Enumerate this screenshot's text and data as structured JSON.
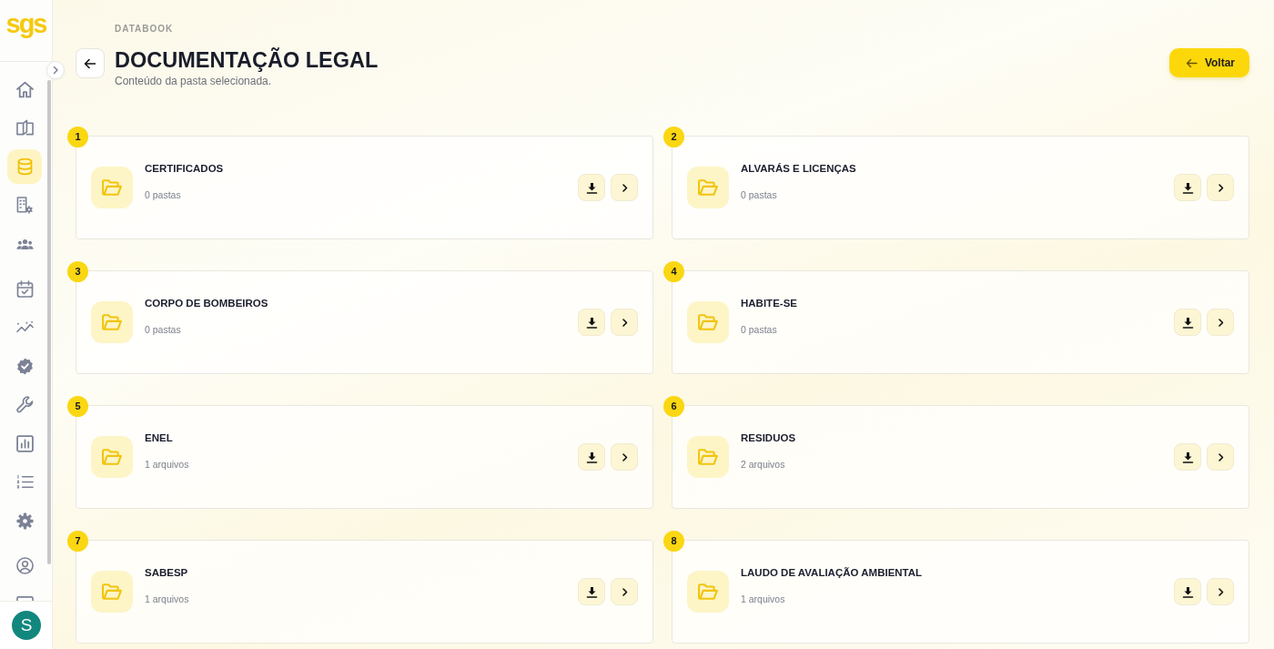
{
  "sidebar": {
    "logo": "sgs",
    "expanded": false,
    "sections": [
      {
        "items": [
          {
            "selected": false
          },
          {
            "selected": false
          },
          {
            "selected": true
          },
          {
            "selected": false
          },
          {
            "selected": false
          }
        ]
      },
      {
        "items": [
          {
            "selected": false
          },
          {
            "selected": false
          },
          {
            "selected": false
          },
          {
            "selected": false
          },
          {
            "selected": false
          },
          {
            "selected": false
          },
          {
            "selected": false
          }
        ]
      },
      {
        "items": [
          {
            "selected": false
          },
          {
            "selected": false
          }
        ]
      }
    ],
    "avatar": "S"
  },
  "header": {
    "breadcrumb": "DATABOOK",
    "title": "DOCUMENTAÇÃO LEGAL",
    "subtitle": "Conteúdo da pasta selecionada.",
    "back_button": "Voltar"
  },
  "folders": [
    {
      "number": "1",
      "title": "CERTIFICADOS",
      "count": "0 pastas"
    },
    {
      "number": "2",
      "title": "ALVARÁS E LICENÇAS",
      "count": "0 pastas"
    },
    {
      "number": "3",
      "title": "CORPO DE BOMBEIROS",
      "count": "0 pastas"
    },
    {
      "number": "4",
      "title": "HABITE-SE",
      "count": "0 pastas"
    },
    {
      "number": "5",
      "title": "ENEL",
      "count": "1 arquivos"
    },
    {
      "number": "6",
      "title": "RESIDUOS",
      "count": "2 arquivos"
    },
    {
      "number": "7",
      "title": "SABESP",
      "count": "1 arquivos"
    },
    {
      "number": "8",
      "title": "LAUDO DE AVALIAÇÃO AMBIENTAL",
      "count": "1 arquivos"
    }
  ]
}
